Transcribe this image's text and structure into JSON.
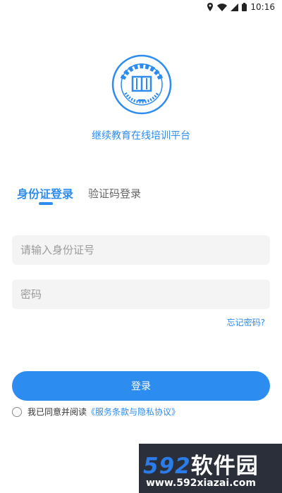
{
  "status_bar": {
    "time": "10:16",
    "icons": [
      "location-icon",
      "wifi-icon",
      "signal-icon",
      "battery-icon"
    ]
  },
  "logo": {
    "name": "university-logo",
    "emblem_text": "兰州城市学院",
    "emblem_english": "Lanzhou City University",
    "color": "#2D8CF0"
  },
  "platform_title": "继续教育在线培训平台",
  "tabs": [
    {
      "label": "身份证登录",
      "active": true
    },
    {
      "label": "验证码登录",
      "active": false
    }
  ],
  "form": {
    "id_placeholder": "请输入身份证号",
    "password_placeholder": "密码",
    "forgot_label": "忘记密码?"
  },
  "login_button": "登录",
  "agreement": {
    "prefix": "我已同意并阅读",
    "link": "《服务条款与隐私协议》"
  },
  "watermark": {
    "brand_number": "592",
    "brand_text": "软件园",
    "url": "www.592xiazai.com"
  },
  "colors": {
    "accent": "#2D8CF0",
    "input_background": "#F4F4F4"
  }
}
